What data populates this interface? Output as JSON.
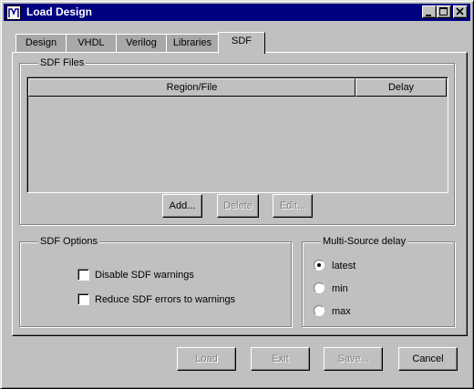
{
  "window": {
    "title": "Load Design",
    "icon": "modelsim-app-icon",
    "controls": [
      "minimize-icon",
      "maximize-icon",
      "close-icon"
    ]
  },
  "tabs": [
    {
      "label": "Design",
      "active": false
    },
    {
      "label": "VHDL",
      "active": false
    },
    {
      "label": "Verilog",
      "active": false
    },
    {
      "label": "Libraries",
      "active": false
    },
    {
      "label": "SDF",
      "active": true
    }
  ],
  "sdf_files": {
    "group_label": "SDF Files",
    "columns": [
      "Region/File",
      "Delay"
    ],
    "rows": [],
    "buttons": {
      "add": {
        "label": "Add...",
        "enabled": true
      },
      "delete": {
        "label": "Delete",
        "enabled": false
      },
      "edit": {
        "label": "Edit...",
        "enabled": false
      }
    }
  },
  "sdf_options": {
    "group_label": "SDF Options",
    "disable_warnings": {
      "label": "Disable SDF warnings",
      "checked": false
    },
    "reduce_errors": {
      "label": "Reduce SDF errors to warnings",
      "checked": false
    }
  },
  "multi_source_delay": {
    "group_label": "Multi-Source delay",
    "options": [
      {
        "label": "latest",
        "selected": true
      },
      {
        "label": "min",
        "selected": false
      },
      {
        "label": "max",
        "selected": false
      }
    ]
  },
  "footer": {
    "load": {
      "label": "Load",
      "enabled": false
    },
    "exit": {
      "label": "Exit",
      "enabled": false
    },
    "save": {
      "label": "Save...",
      "enabled": false
    },
    "cancel": {
      "label": "Cancel",
      "enabled": true
    }
  }
}
